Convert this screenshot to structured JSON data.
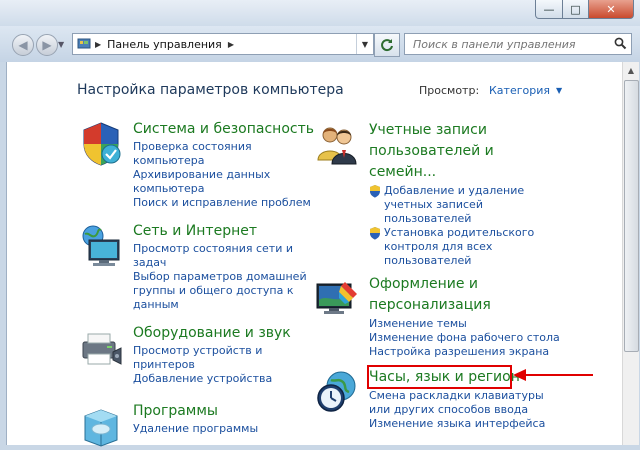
{
  "window": {
    "min_symbol": "—",
    "max_symbol": "□",
    "close_symbol": "✕"
  },
  "nav": {
    "back_symbol": "◀",
    "forward_symbol": "▶",
    "history_symbol": "▼",
    "address": "Панель управления",
    "address_sep": "▶",
    "address_dropdown": "▼",
    "search_placeholder": "Поиск в панели управления"
  },
  "page": {
    "title": "Настройка параметров компьютера",
    "view_by_label": "Просмотр:",
    "view_by_value": "Категория",
    "view_by_caret": "▼"
  },
  "scroll_up_symbol": "▲",
  "left_categories": [
    {
      "title": "Система и безопасность",
      "links": [
        "Проверка состояния",
        "компьютера",
        "Архивирование данных",
        "компьютера",
        "Поиск и исправление проблем"
      ]
    },
    {
      "title": "Сеть и Интернет",
      "links": [
        "Просмотр состояния сети и",
        "задач",
        "Выбор параметров домашней",
        "группы и общего доступа к",
        "данным"
      ]
    },
    {
      "title": "Оборудование и звук",
      "links": [
        "Просмотр устройств и",
        "принтеров",
        "Добавление устройства"
      ]
    },
    {
      "title": "Программы",
      "links": [
        "Удаление программы"
      ]
    }
  ],
  "right_categories": [
    {
      "title_lines": [
        "Учетные записи",
        "пользователей и",
        "семейн..."
      ],
      "shield_links": [
        [
          "Добавление и удаление",
          "учетных записей",
          "пользователей"
        ],
        [
          "Установка родительского",
          "контроля для всех",
          "пользователей"
        ]
      ]
    },
    {
      "title_lines": [
        "Оформление и",
        "персонализация"
      ],
      "links": [
        "Изменение темы",
        "Изменение фона рабочего стола",
        "Настройка разрешения экрана"
      ]
    },
    {
      "title_lines": [
        "Часы, язык и регион"
      ],
      "links": [
        "Смена раскладки клавиатуры",
        "или других способов ввода",
        "Изменение языка интерфейса"
      ]
    }
  ],
  "colors": {
    "category_title": "#1c7a21",
    "link": "#1b4f9e",
    "highlight": "#e00000"
  }
}
